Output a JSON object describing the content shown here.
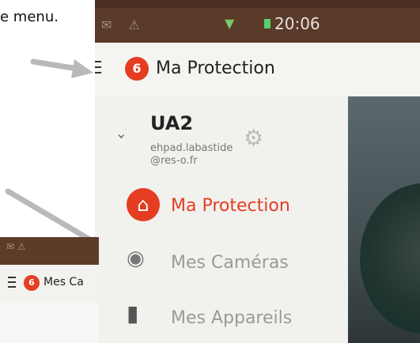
{
  "caption": {
    "line1": "",
    "line2": "e menu."
  },
  "status_bar": {
    "time": "20:06"
  },
  "app_bar": {
    "title": "Ma Protection",
    "logo_letter": "6"
  },
  "account": {
    "name": "UA2",
    "email": "ehpad.labastide@res-o.fr"
  },
  "nav": [
    {
      "label": "Ma Protection",
      "icon": "home-icon",
      "color": "#e43d22"
    },
    {
      "label": "Mes Caméras",
      "icon": "eye-icon",
      "color": "#9a9a9a"
    },
    {
      "label": "Mes Appareils",
      "icon": "plug-icon",
      "color": "#9a9a9a"
    }
  ],
  "inset": {
    "title": "Mes Ca"
  },
  "colors": {
    "brand": "#e43d22",
    "arrow": "#b9b9b9"
  }
}
